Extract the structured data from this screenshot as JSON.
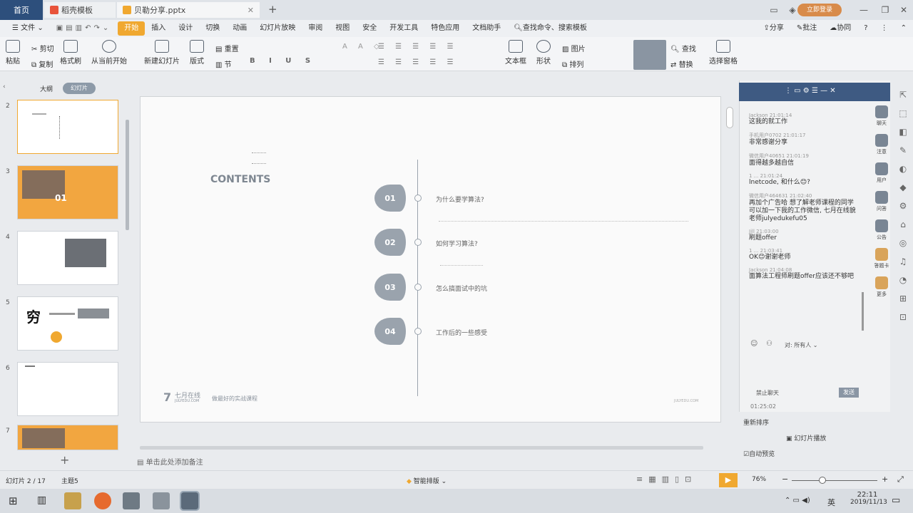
{
  "titlebar": {
    "home_tab": "首页",
    "tab1": "稻壳模板",
    "tab2": "贝勒分享.pptx",
    "login": "立即登录"
  },
  "menu": {
    "file": "文件",
    "items": [
      "开始",
      "插入",
      "设计",
      "切换",
      "动画",
      "幻灯片放映",
      "审阅",
      "视图",
      "安全",
      "开发工具",
      "特色应用",
      "文档助手"
    ],
    "search": "查找命令、搜索模板",
    "share": "分享",
    "comment": "批注",
    "collab": "协同"
  },
  "ribbon": {
    "paste": "粘贴",
    "cut": "剪切",
    "copy": "复制",
    "format_painter": "格式刷",
    "play_from_current": "从当前开始",
    "new_slide": "新建幻灯片",
    "layout": "版式",
    "reset": "重置",
    "section": "节",
    "textbox": "文本框",
    "shape": "形状",
    "picture": "图片",
    "arrange": "排列",
    "find": "查找",
    "replace": "替换",
    "select_pane": "选择窗格"
  },
  "leftpanel": {
    "outline_tab": "大纲",
    "slides_tab": "幻灯片",
    "slide_numbers": [
      "2",
      "3",
      "4",
      "5",
      "6",
      "7"
    ],
    "thumb3_label": "01",
    "thumb5_char": "穷"
  },
  "slide": {
    "title": "CONTENTS",
    "items": [
      {
        "num": "01",
        "text": "为什么要学算法?"
      },
      {
        "num": "02",
        "text": "如何学习算法?"
      },
      {
        "num": "03",
        "text": "怎么搞面试中的坑"
      },
      {
        "num": "04",
        "text": "工作后的一些感受"
      }
    ],
    "logo_cn": "七月在线",
    "logo_en": "JULYEDU.COM",
    "slogan": "做最好的实战课程",
    "footer_right": "JULYEDU.COM"
  },
  "notes_placeholder": "单击此处添加备注",
  "chat": {
    "messages": [
      {
        "meta": "Jackson 21:01:14",
        "text": "这我的就工作"
      },
      {
        "meta": "手机用户0702 21:01:17",
        "text": "非常感谢分享"
      },
      {
        "meta": "微信用户40651 21:01:19",
        "text": "面得越多越自信"
      },
      {
        "meta": "1 ... 21:01:24",
        "text": "lnetcode, 和什么😊?"
      },
      {
        "meta": "微信用户464631 21:02:40",
        "text": "再加个广告哈 想了解老师课程的同学 可以加一下我的工作微信, 七月在线貌老师julyedukefu05"
      },
      {
        "meta": "Jill 21:03:00",
        "text": "刷题offer"
      },
      {
        "meta": "1 ... 21:03:41",
        "text": "OK😊谢谢老师"
      },
      {
        "meta": "Jackson 21:04:08",
        "text": "面算法工程师刷题offer应该还不够吧"
      }
    ],
    "to_label": "所有人",
    "stop_chat": "禁止聊天",
    "send": "发送",
    "timer": "01:25:02",
    "bottom_label": "重新排序",
    "slideshow_btn": "幻灯片播放",
    "auto_preview": "自动预览",
    "side_icons": [
      "聊天",
      "注意",
      "用户",
      "问答",
      "公告",
      "答题卡",
      "更多"
    ]
  },
  "status": {
    "slide_count": "幻灯片 2 / 17",
    "theme": "主题5",
    "smart": "智能排版",
    "zoom": "76%"
  },
  "taskbar": {
    "time": "22:11",
    "date": "2019/11/13",
    "ime": "英"
  }
}
